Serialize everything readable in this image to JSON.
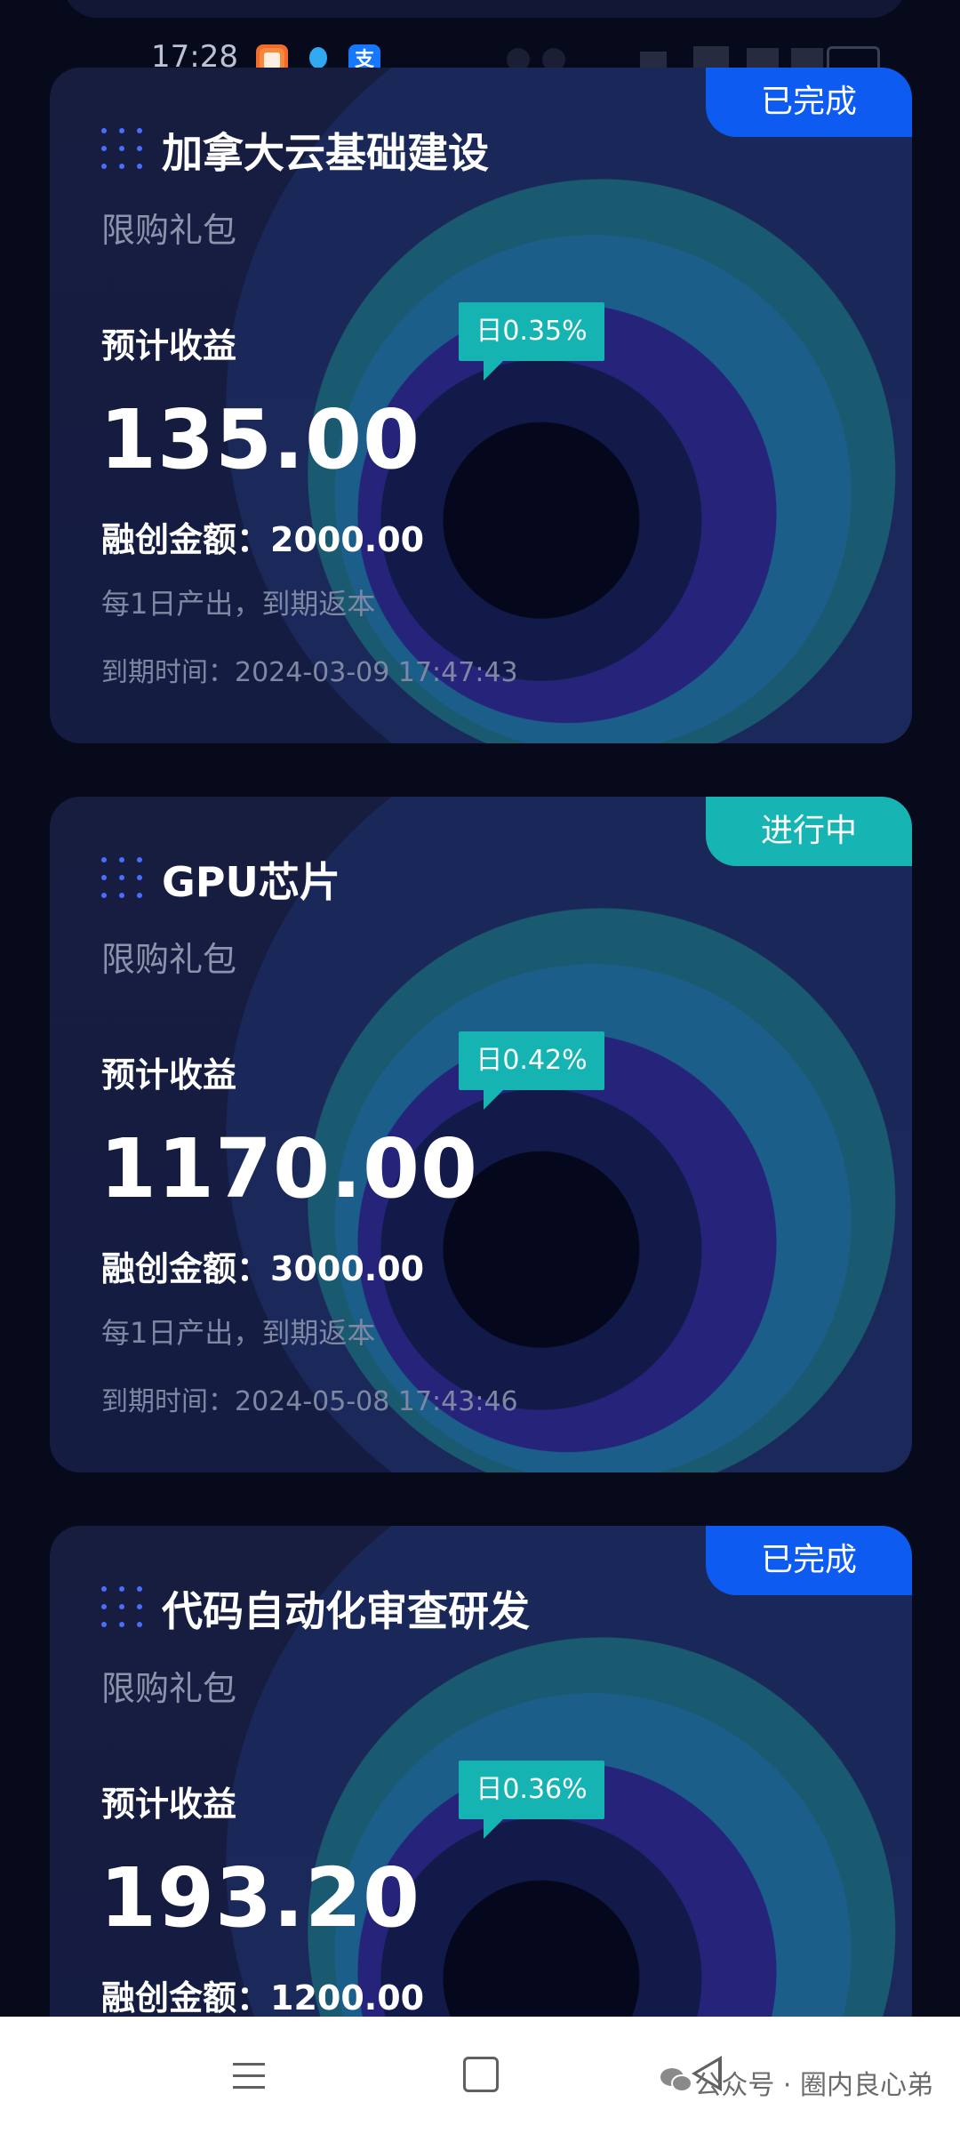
{
  "status_bar": {
    "time": "17:28",
    "icons": [
      "app-icon",
      "qq-icon",
      "alipay-icon"
    ],
    "alipay_glyph": "支"
  },
  "cards": [
    {
      "title": "加拿大云基础建设",
      "subtitle": "限购礼包",
      "status": "已完成",
      "income_label": "预计收益",
      "daily_rate": "日0.35%",
      "income_value": "135.00",
      "amount_label": "融创金额：",
      "amount_value": "2000.00",
      "note": "每1日产出，到期返本",
      "expire_label": "到期时间：",
      "expire_value": "2024-03-09 17:47:43"
    },
    {
      "title": "GPU芯片",
      "subtitle": "限购礼包",
      "status": "进行中",
      "income_label": "预计收益",
      "daily_rate": "日0.42%",
      "income_value": "1170.00",
      "amount_label": "融创金额：",
      "amount_value": "3000.00",
      "note": "每1日产出，到期返本",
      "expire_label": "到期时间：",
      "expire_value": "2024-05-08 17:43:46"
    },
    {
      "title": "代码自动化审查研发",
      "subtitle": "限购礼包",
      "status": "已完成",
      "income_label": "预计收益",
      "daily_rate": "日0.36%",
      "income_value": "193.20",
      "amount_label": "融创金额：",
      "amount_value": "1200.00"
    }
  ],
  "colors": {
    "status_done": "#0d5bf0",
    "status_in_progress": "#17b4b4",
    "rate_badge": "#16b3b3",
    "card_background": "#161d3f"
  },
  "watermark": "公众号 · 圈内良心弟"
}
